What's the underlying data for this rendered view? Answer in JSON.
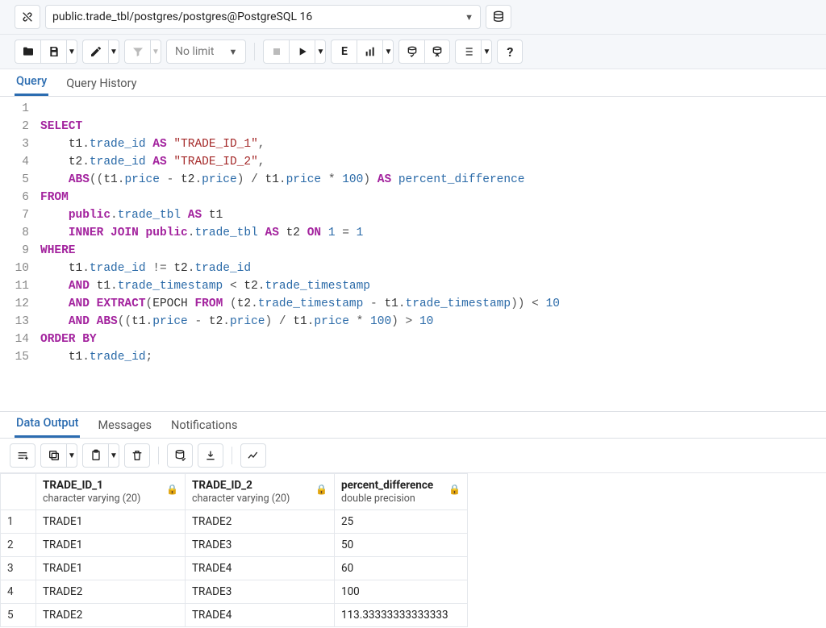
{
  "topbar": {
    "connection": "public.trade_tbl/postgres/postgres@PostgreSQL 16"
  },
  "toolbar": {
    "limit": "No limit",
    "explain_letter": "E"
  },
  "tabs": {
    "query": "Query",
    "history": "Query History"
  },
  "editor": {
    "lines": [
      "1",
      "2",
      "3",
      "4",
      "5",
      "6",
      "7",
      "8",
      "9",
      "10",
      "11",
      "12",
      "13",
      "14",
      "15"
    ]
  },
  "sql": {
    "SELECT": "SELECT",
    "FROM": "FROM",
    "WHERE": "WHERE",
    "ORDER_BY": "ORDER BY",
    "AS": "AS",
    "ABS": "ABS",
    "INNER": "INNER",
    "JOIN": "JOIN",
    "ON": "ON",
    "AND": "AND",
    "EXTRACT": "EXTRACT",
    "EPOCH": "EPOCH",
    "FROM2": "FROM",
    "t1": "t1",
    "t2": "t2",
    "dot": ".",
    "comma": ",",
    "lp": "(",
    "rp": ")",
    "semi": ";",
    "trade_id": "trade_id",
    "price": "price",
    "trade_timestamp": "trade_timestamp",
    "public": "public",
    "trade_tbl": "trade_tbl",
    "percent_difference": "percent_difference",
    "str1": "\"TRADE_ID_1\"",
    "str2": "\"TRADE_ID_2\"",
    "n1": "1",
    "n10": "10",
    "n100": "100",
    "minus": " - ",
    "slash": " / ",
    "star": " * ",
    "neq": " != ",
    "lt": " < ",
    "gt": " > ",
    "eq": " = "
  },
  "out_tabs": {
    "data": "Data Output",
    "messages": "Messages",
    "notifications": "Notifications"
  },
  "columns": [
    {
      "name": "TRADE_ID_1",
      "type": "character varying (20)"
    },
    {
      "name": "TRADE_ID_2",
      "type": "character varying (20)"
    },
    {
      "name": "percent_difference",
      "type": "double precision"
    }
  ],
  "rows": [
    {
      "n": "1",
      "a": "TRADE1",
      "b": "TRADE2",
      "c": "25"
    },
    {
      "n": "2",
      "a": "TRADE1",
      "b": "TRADE3",
      "c": "50"
    },
    {
      "n": "3",
      "a": "TRADE1",
      "b": "TRADE4",
      "c": "60"
    },
    {
      "n": "4",
      "a": "TRADE2",
      "b": "TRADE3",
      "c": "100"
    },
    {
      "n": "5",
      "a": "TRADE2",
      "b": "TRADE4",
      "c": "113.33333333333333"
    }
  ]
}
